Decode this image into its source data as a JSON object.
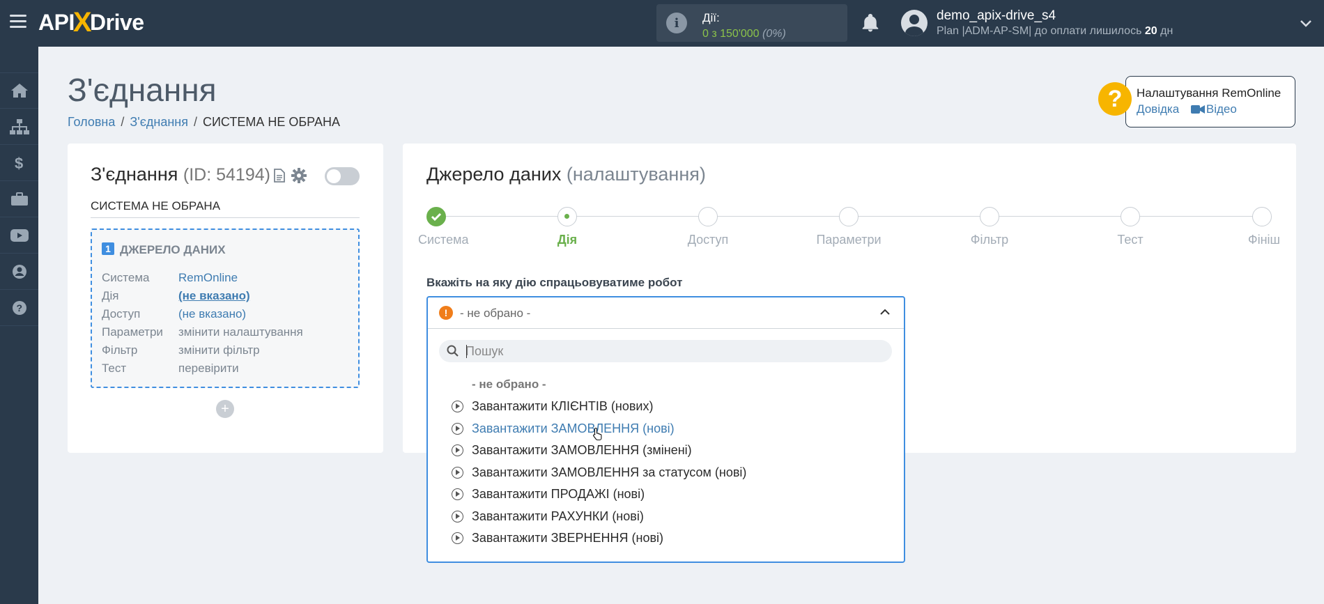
{
  "topbar": {
    "logo_left": "API",
    "logo_x": "X",
    "logo_right": "Drive",
    "actions_label": "Дії:",
    "actions_value": "0 з 150'000",
    "actions_pct": "(0%)",
    "user_name": "demo_apix-drive_s4",
    "plan_prefix": "Plan |ADM-AP-SM| до оплати лишилось",
    "plan_days": "20",
    "plan_suffix": "дн"
  },
  "sidebar": {
    "items": [
      "home-icon",
      "sitemap-icon",
      "dollar-icon",
      "briefcase-icon",
      "youtube-icon",
      "user-icon",
      "question-icon"
    ]
  },
  "page": {
    "title": "З'єднання",
    "breadcrumb": {
      "home": "Головна",
      "connections": "З'єднання",
      "current": "СИСТЕМА НЕ ОБРАНА"
    }
  },
  "help": {
    "title": "Налаштування RemOnline",
    "help_link": "Довідка",
    "video_link": "Відео"
  },
  "connection_card": {
    "title": "З'єднання",
    "id_text": "(ID: 54194)",
    "system_label": "СИСТЕМА НЕ ОБРАНА",
    "source": {
      "number": "1",
      "title": "ДЖЕРЕЛО ДАНИХ",
      "rows": [
        {
          "key": "Система",
          "value": "RemOnline"
        },
        {
          "key": "Дія",
          "value": "(не вказано)"
        },
        {
          "key": "Доступ",
          "value": "(не вказано)"
        },
        {
          "key": "Параметри",
          "value": "змінити налаштування"
        },
        {
          "key": "Фільтр",
          "value": "змінити фільтр"
        },
        {
          "key": "Тест",
          "value": "перевірити"
        }
      ]
    },
    "add_symbol": "+"
  },
  "settings_card": {
    "title": "Джерело даних",
    "subtitle": "(налаштування)",
    "steps": [
      "Система",
      "Дія",
      "Доступ",
      "Параметри",
      "Фільтр",
      "Тест",
      "Фініш"
    ],
    "current_step": 1,
    "field_label": "Вкажіть на яку дію спрацьовуватиме робот"
  },
  "dropdown": {
    "selected": "- не обрано -",
    "search_placeholder": "Пошук",
    "none_option": "- не обрано -",
    "options": [
      "Завантажити КЛІЄНТІВ (нових)",
      "Завантажити ЗАМОВЛЕННЯ (нові)",
      "Завантажити ЗАМОВЛЕННЯ (змінені)",
      "Завантажити ЗАМОВЛЕННЯ за статусом (нові)",
      "Завантажити ПРОДАЖІ (нові)",
      "Завантажити РАХУНКИ (нові)",
      "Завантажити ЗВЕРНЕННЯ (нові)"
    ],
    "hovered_index": 1
  },
  "colors": {
    "topbar": "#2a3a4b",
    "accent_blue": "#3f8ee0",
    "link": "#3f7cb1",
    "success": "#6ab04c",
    "warning": "#f07d1a",
    "help_yellow": "#f7b500"
  }
}
